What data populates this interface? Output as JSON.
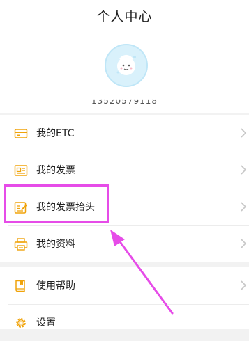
{
  "header": {
    "title": "个人中心"
  },
  "profile": {
    "avatar_icon": "avatar-face-icon",
    "phone": "13520579118"
  },
  "menu": {
    "items": [
      {
        "label": "我的ETC",
        "icon": "card-icon"
      },
      {
        "label": "我的发票",
        "icon": "invoice-icon"
      },
      {
        "label": "我的发票抬头",
        "icon": "edit-note-icon"
      },
      {
        "label": "我的资料",
        "icon": "printer-icon"
      }
    ],
    "secondary": [
      {
        "label": "使用帮助",
        "icon": "book-icon"
      },
      {
        "label": "设置",
        "icon": "gear-icon"
      }
    ]
  },
  "annotation": {
    "color": "#e64ce8"
  },
  "colors": {
    "accent": "#f0a30a",
    "chevron": "#c7c7c7"
  }
}
